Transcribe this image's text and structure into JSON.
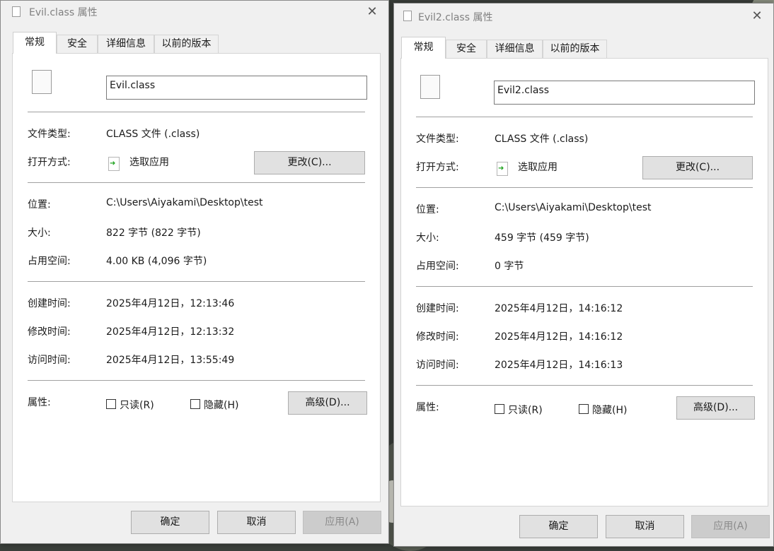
{
  "windows": [
    {
      "title": "Evil.class 属性",
      "tabs": [
        "常规",
        "安全",
        "详细信息",
        "以前的版本"
      ],
      "filename": "Evil.class",
      "file_type_label": "文件类型:",
      "file_type": "CLASS 文件 (.class)",
      "open_with_label": "打开方式:",
      "open_with": "选取应用",
      "change_button": "更改(C)...",
      "location_label": "位置:",
      "location": "C:\\Users\\Aiyakami\\Desktop\\test",
      "size_label": "大小:",
      "size": "822 字节 (822 字节)",
      "disk_size_label": "占用空间:",
      "disk_size": "4.00 KB (4,096 字节)",
      "created_label": "创建时间:",
      "created": "2025年4月12日，12:13:46",
      "modified_label": "修改时间:",
      "modified": "2025年4月12日，12:13:32",
      "accessed_label": "访问时间:",
      "accessed": "2025年4月12日，13:55:49",
      "attributes_label": "属性:",
      "readonly_label": "只读(R)",
      "readonly_checked": false,
      "hidden_label": "隐藏(H)",
      "hidden_checked": false,
      "advanced_button": "高级(D)...",
      "ok_button": "确定",
      "cancel_button": "取消",
      "apply_button": "应用(A)",
      "close_icon": "close-icon"
    },
    {
      "title": "Evil2.class 属性",
      "tabs": [
        "常规",
        "安全",
        "详细信息",
        "以前的版本"
      ],
      "filename": "Evil2.class",
      "file_type_label": "文件类型:",
      "file_type": "CLASS 文件 (.class)",
      "open_with_label": "打开方式:",
      "open_with": "选取应用",
      "change_button": "更改(C)...",
      "location_label": "位置:",
      "location": "C:\\Users\\Aiyakami\\Desktop\\test",
      "size_label": "大小:",
      "size": "459 字节 (459 字节)",
      "disk_size_label": "占用空间:",
      "disk_size": "0 字节",
      "created_label": "创建时间:",
      "created": "2025年4月12日，14:16:12",
      "modified_label": "修改时间:",
      "modified": "2025年4月12日，14:16:12",
      "accessed_label": "访问时间:",
      "accessed": "2025年4月12日，14:16:13",
      "attributes_label": "属性:",
      "readonly_label": "只读(R)",
      "readonly_checked": false,
      "hidden_label": "隐藏(H)",
      "hidden_checked": false,
      "advanced_button": "高级(D)...",
      "ok_button": "确定",
      "cancel_button": "取消",
      "apply_button": "应用(A)",
      "close_icon": "close-icon"
    }
  ],
  "colors": {
    "dialog_bg": "#f0f0f0",
    "panel_bg": "#ffffff",
    "button_bg": "#e1e1e1",
    "disabled_button_bg": "#cccccc",
    "title_text": "#808080"
  }
}
